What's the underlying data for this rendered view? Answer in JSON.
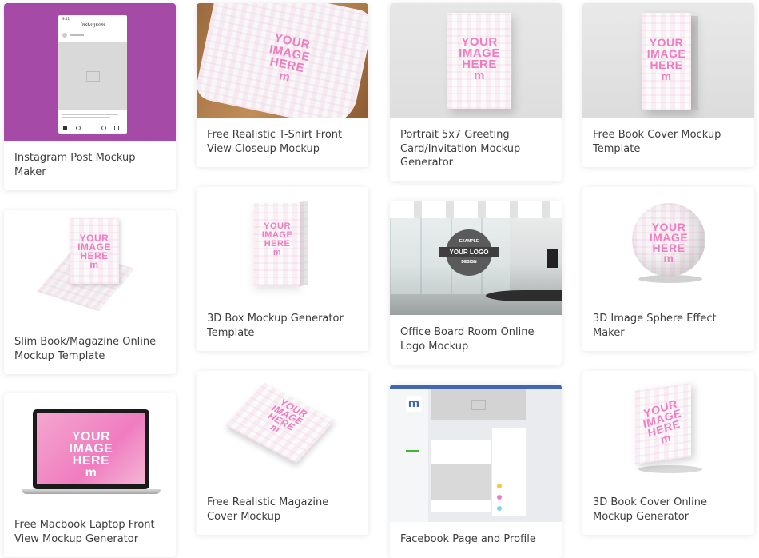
{
  "cards": [
    {
      "title": "Instagram Post Mockup Maker",
      "icon": "instagram-phone-mockup"
    },
    {
      "title": "Free Realistic T-Shirt Front View Closeup Mockup",
      "icon": "tshirt-mockup"
    },
    {
      "title": "Portrait 5x7 Greeting Card/Invitation Mockup Generator",
      "icon": "greeting-card-mockup"
    },
    {
      "title": "Free Book Cover Mockup Template",
      "icon": "book-cover-mockup"
    },
    {
      "title": "Slim Book/Magazine Online Mockup Template",
      "icon": "slim-book-mockup"
    },
    {
      "title": "3D Box Mockup Generator Template",
      "icon": "box-mockup"
    },
    {
      "title": "Office Board Room Online Logo Mockup",
      "icon": "office-logo-mockup"
    },
    {
      "title": "3D Image Sphere Effect Maker",
      "icon": "sphere-mockup"
    },
    {
      "title": "Free Macbook Laptop Front View Mockup Generator",
      "icon": "laptop-mockup"
    },
    {
      "title": "Free Realistic Magazine Cover Mockup",
      "icon": "magazine-mockup"
    },
    {
      "title": "Facebook Page and Profile",
      "icon": "facebook-page-mockup"
    },
    {
      "title": "3D Book Cover Online Mockup Generator",
      "icon": "3d-book-mockup"
    }
  ],
  "placeholder": {
    "line1": "YOUR",
    "line2": "IMAGE",
    "line3": "HERE",
    "mark": "m"
  },
  "instagram": {
    "time": "9:41",
    "logo": "Instagram"
  },
  "office": {
    "sign_top": "EXAMPLE",
    "sign_main": "YOUR LOGO",
    "sign_bottom": "DESIGN"
  },
  "colors": {
    "accent": "#f07cc0",
    "instagram_bg": "#a54aa6",
    "facebook_blue": "#4267b2"
  }
}
